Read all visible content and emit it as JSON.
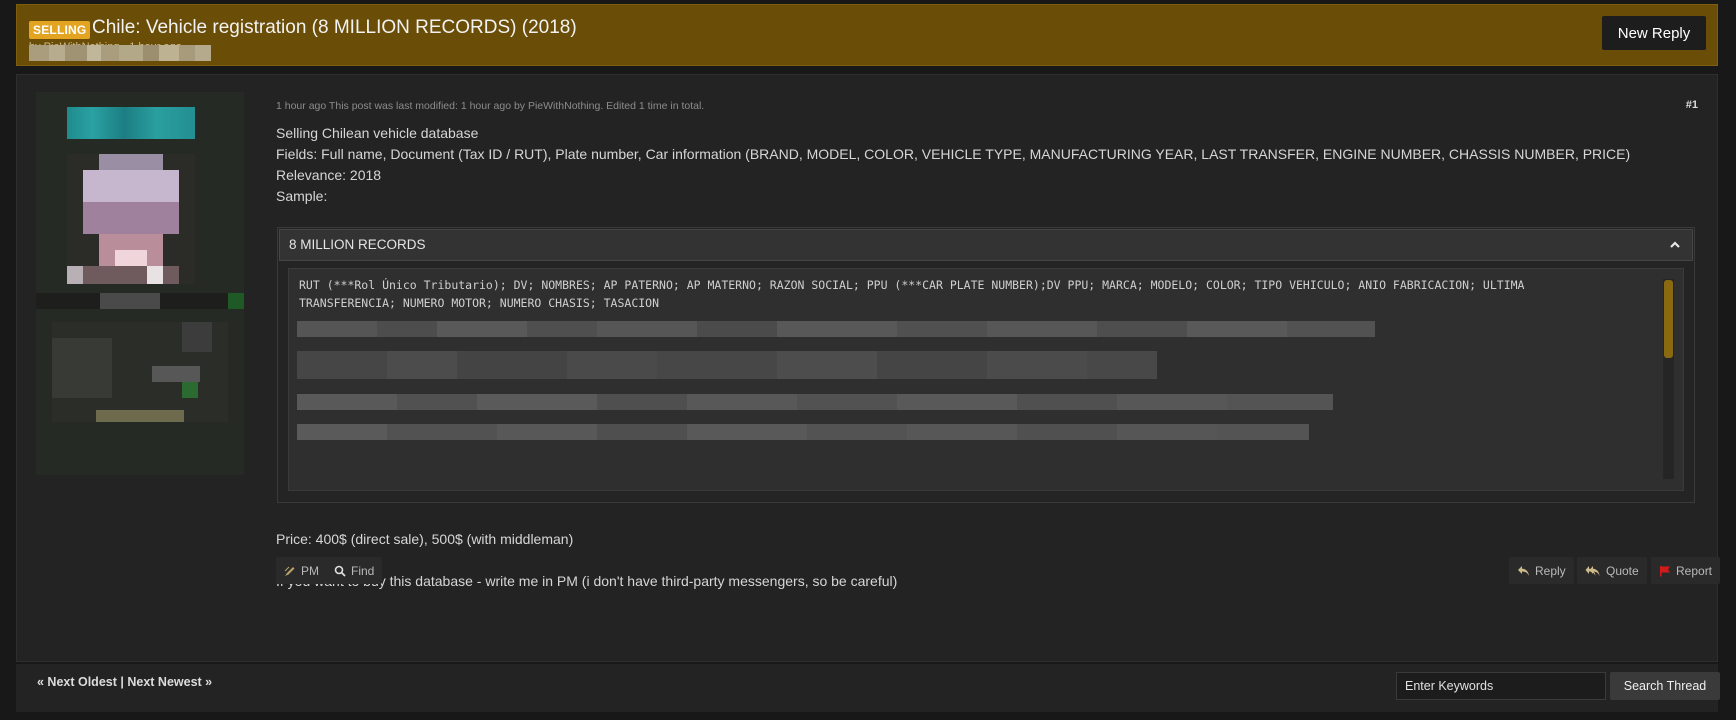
{
  "thread": {
    "badge": "SELLING",
    "title": "Chile: Vehicle registration (8 MILLION RECORDS) (2018)",
    "author_line": "by PieWithNothing - 1 hour ago",
    "new_reply_label": "New Reply"
  },
  "post": {
    "meta": "1 hour ago  This post was last modified: 1 hour ago by PieWithNothing. Edited 1 time in total.",
    "number": "#1",
    "lines": [
      "Selling Chilean vehicle database",
      "Fields: Full name, Document (Tax ID / RUT), Plate number, Car information (BRAND, MODEL, COLOR, VEHICLE TYPE, MANUFACTURING YEAR, LAST TRANSFER, ENGINE NUMBER, CHASSIS NUMBER, PRICE)",
      "Relevance: 2018",
      "Sample:"
    ],
    "spoiler_title": "8 MILLION RECORDS",
    "code_header": "RUT (***Rol Único Tributario); DV; NOMBRES; AP PATERNO; AP MATERNO; RAZON SOCIAL; PPU (***CAR PLATE NUMBER);DV PPU; MARCA; MODELO; COLOR; TIPO VEHICULO; ANIO FABRICACION; ULTIMA TRANSFERENCIA; NUMERO MOTOR; NUMERO CHASIS; TASACION",
    "price": "Price: 400$ (direct sale), 500$ (with middleman)",
    "contact": "If you want to buy this database - write me in PM (i don't have third-party messengers, so be careful)"
  },
  "actions": {
    "pm": "PM",
    "find": "Find",
    "reply": "Reply",
    "quote": "Quote",
    "report": "Report"
  },
  "footer": {
    "next_oldest": "« Next Oldest",
    "separator": "|",
    "next_newest": "Next Newest »",
    "search_placeholder": "Enter Keywords",
    "search_button": "Search Thread"
  },
  "colors": {
    "header_bg": "#6a4d07",
    "badge_bg": "#e2a421",
    "scroll_thumb": "#8a6a10",
    "report_flag": "#d11a1a"
  },
  "icons": [
    "pen-icon",
    "search-icon",
    "reply-icon",
    "quote-icon",
    "flag-icon",
    "chevron-up-icon"
  ]
}
